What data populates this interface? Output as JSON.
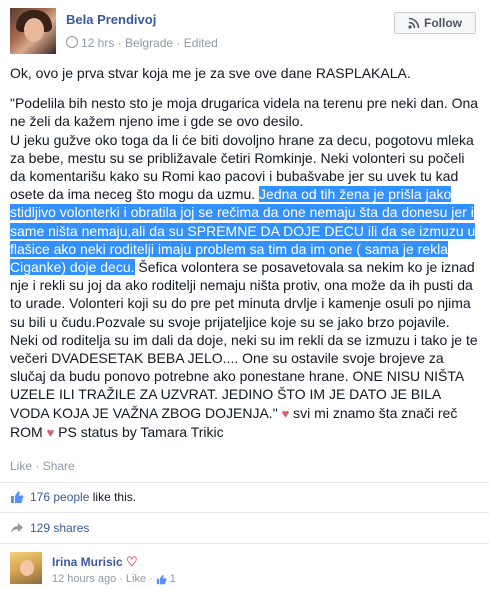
{
  "post": {
    "author": "Bela Prendivoj",
    "time": "12 hrs",
    "location": "Belgrade",
    "edited": "Edited",
    "meta_sep": "·",
    "follow_label": "Follow",
    "intro": "Ok, ovo je prva stvar koja me je za sve ove dane RASPLAKALA.",
    "story_a": "\"Podelila bih nesto sto je moja drugarica videla na terenu pre neki dan. Ona ne želi da kažem njeno ime i gde se ovo desilo.\nU jeku gužve oko toga da li će biti dovoljno hrane za decu, pogotovu mleka za bebe, mestu su se približavale četiri Romkinje. Neki volonteri su počeli da komentarišu kako su Romi kao pacovi i bubašvabe jer su uvek tu kad osete da ima neceg što mogu da uzmu. ",
    "story_highlight": "Jedna od tih žena je prišla jako stidljivo volonterki i obratila joj se rečima da one nemaju šta da donesu jer i same ništa nemaju,ali da su SPREMNE DA DOJE DECU ili da se izmuzu u flašice ako neki roditelji imaju problem sa tim da im one ( sama je rekla Ciganke) doje decu.",
    "story_b": " Šefica volontera se posavetovala sa nekim ko je iznad nje i rekli su joj da ako roditelji nemaju ništa protiv, ona može da ih pusti da to urade. Volonteri koji su do pre pet minuta drvlje i kamenje osuli po njima su bili u čudu.Pozvale su svoje prijateljice koje su se jako brzo pojavile. Neki od roditelja su im dali da doje, neki su im rekli da se izmuzu i tako je te večeri DVADESETAK BEBA JELO.... One su ostavile svoje brojeve za slučaj da budu ponovo potrebne ako ponestane hrane. ONE NISU NIŠTA UZELE ILI TRAŽILE ZA UZVRAT. JEDINO ŠTO IM JE DATO JE BILA VODA KOJA JE VAŽNA ZBOG DOJENJA.\" ",
    "story_c": " svi mi znamo šta znači reč ROM ",
    "story_d": " PS status by Tamara Trikic"
  },
  "actions": {
    "like": "Like",
    "share": "Share",
    "sep": "·"
  },
  "likes": {
    "count_link": "176 people",
    "suffix": "like this."
  },
  "shares": {
    "label": "129 shares"
  },
  "comment": {
    "author": "Irina Murisic",
    "time": "12 hours ago",
    "like": "Like",
    "sep": "·",
    "likes_count": "1"
  },
  "colors": {
    "link": "#3b5998",
    "highlight": "#3390ff",
    "heart": "#e05b70",
    "muted": "#9197a3"
  },
  "icons": [
    "rss-icon",
    "heart-icon",
    "thumbs-up-icon",
    "share-icon"
  ]
}
